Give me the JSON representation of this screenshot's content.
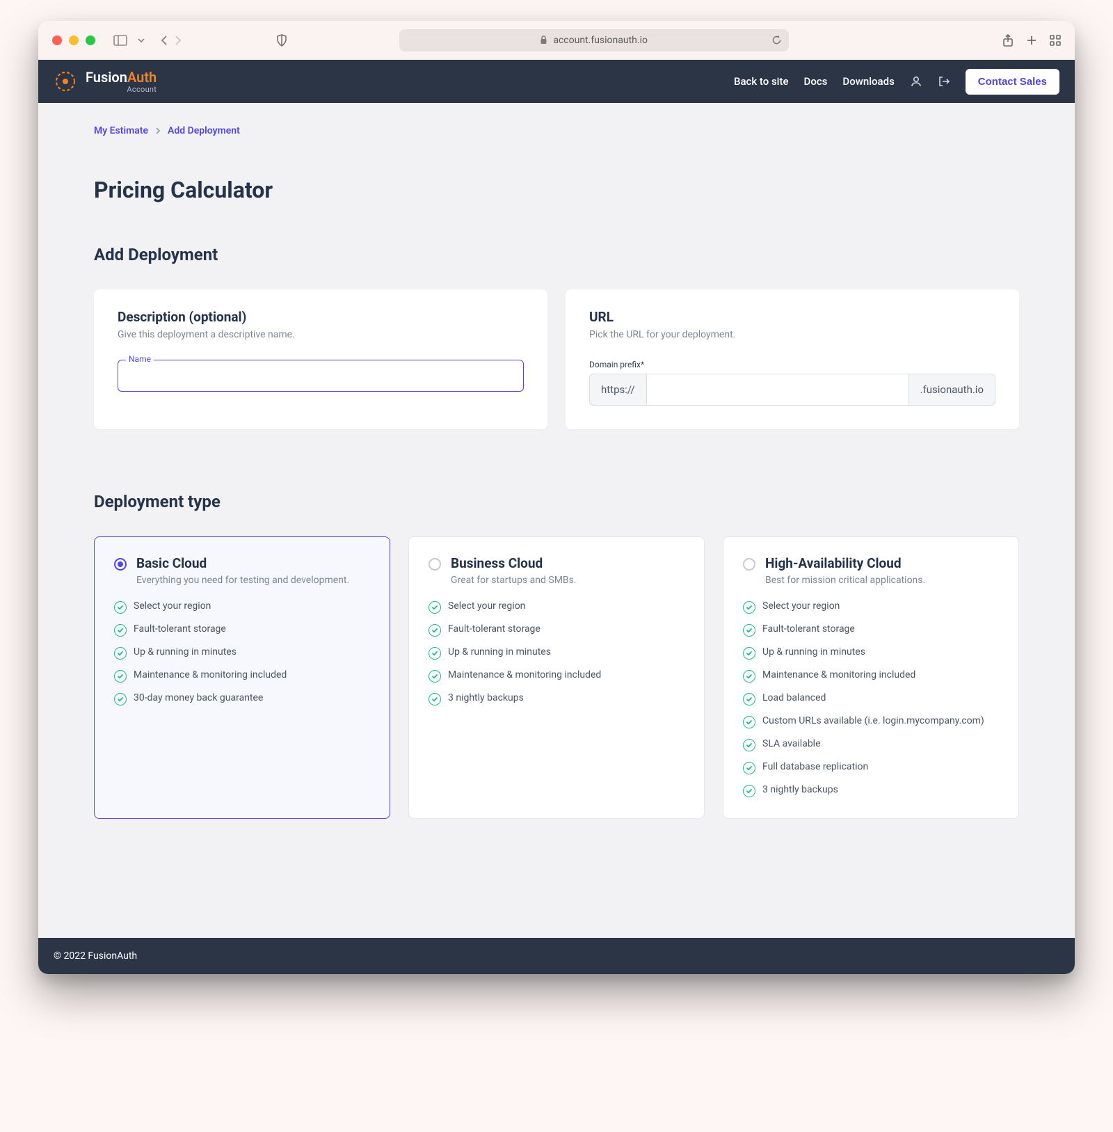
{
  "browser": {
    "url_display": "account.fusionauth.io"
  },
  "header": {
    "logo_primary_a": "Fusion",
    "logo_primary_b": "Auth",
    "logo_sub": "Account",
    "nav": {
      "back": "Back to site",
      "docs": "Docs",
      "downloads": "Downloads"
    },
    "contact": "Contact Sales"
  },
  "breadcrumb": {
    "root": "My Estimate",
    "current": "Add Deployment"
  },
  "page": {
    "title": "Pricing Calculator",
    "section_add": "Add Deployment",
    "section_type": "Deployment type"
  },
  "description_card": {
    "title": "Description (optional)",
    "hint": "Give this deployment a descriptive name.",
    "name_label": "Name",
    "name_value": ""
  },
  "url_card": {
    "title": "URL",
    "hint": "Pick the URL for your deployment.",
    "prefix_label": "Domain prefix*",
    "protocol": "https://",
    "suffix": ".fusionauth.io",
    "value": ""
  },
  "plans": [
    {
      "id": "basic",
      "title": "Basic Cloud",
      "desc": "Everything you need for testing and development.",
      "selected": true,
      "features": [
        "Select your region",
        "Fault-tolerant storage",
        "Up & running in minutes",
        "Maintenance & monitoring included",
        "30-day money back guarantee"
      ]
    },
    {
      "id": "business",
      "title": "Business Cloud",
      "desc": "Great for startups and SMBs.",
      "selected": false,
      "features": [
        "Select your region",
        "Fault-tolerant storage",
        "Up & running in minutes",
        "Maintenance & monitoring included",
        "3 nightly backups"
      ]
    },
    {
      "id": "ha",
      "title": "High-Availability Cloud",
      "desc": "Best for mission critical applications.",
      "selected": false,
      "features": [
        "Select your region",
        "Fault-tolerant storage",
        "Up & running in minutes",
        "Maintenance & monitoring included",
        "Load balanced",
        "Custom URLs available (i.e. login.mycompany.com)",
        "SLA available",
        "Full database replication",
        "3 nightly backups"
      ]
    }
  ],
  "footer": {
    "copyright": "© 2022 FusionAuth"
  }
}
